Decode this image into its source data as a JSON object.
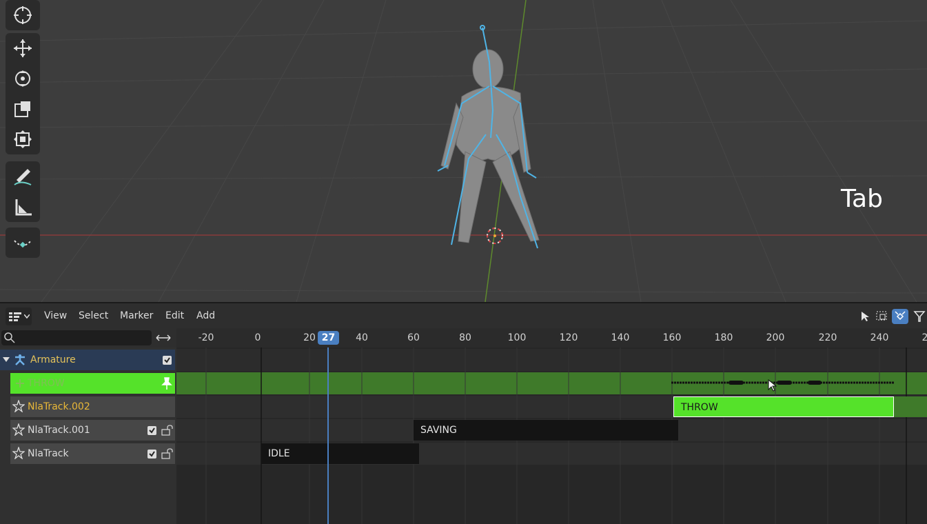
{
  "viewport": {
    "overlay_key": "Tab",
    "tools": [
      "cursor-icon",
      "move-icon",
      "rotate-icon",
      "scale-icon",
      "transform-icon",
      "annotate-icon",
      "measure-icon",
      "add-curve-icon"
    ]
  },
  "nla": {
    "menus": [
      "View",
      "Select",
      "Marker",
      "Edit",
      "Add"
    ],
    "current_frame": "27",
    "ruler_labels": [
      "-20",
      "0",
      "20",
      "40",
      "60",
      "80",
      "100",
      "120",
      "140",
      "160",
      "180",
      "200",
      "220",
      "240",
      "2"
    ],
    "channels": {
      "armature": "Armature",
      "throw_action": "THROW",
      "track2": "NlaTrack.002",
      "track1": "NlaTrack.001",
      "track0": "NlaTrack"
    },
    "strips": {
      "throw": "THROW",
      "saving": "SAVING",
      "idle": "IDLE"
    },
    "colors": {
      "action_green": "#55e22a",
      "selected_blue": "#4a7fc1",
      "strip_dark": "#141414"
    }
  }
}
